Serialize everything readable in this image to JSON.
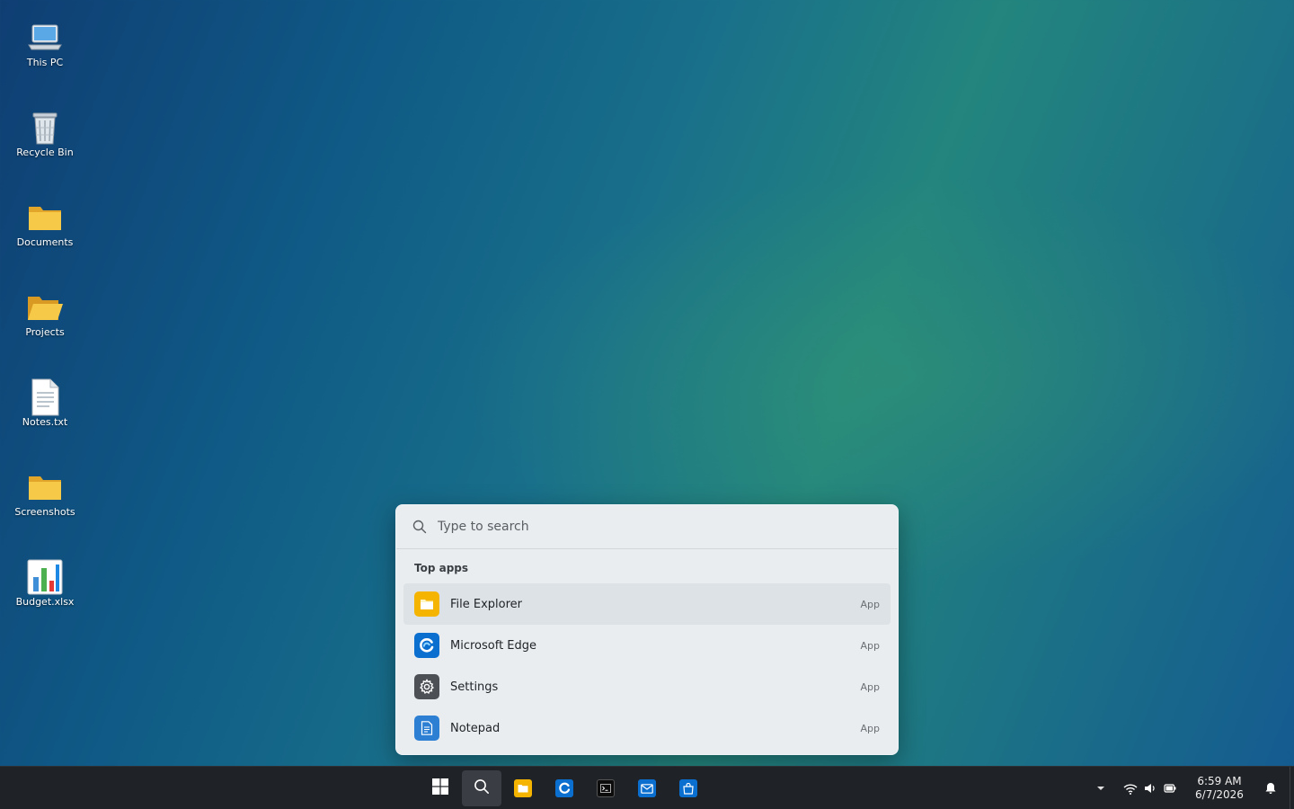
{
  "desktop": {
    "icons": [
      {
        "label": "This PC",
        "icon": "computer-icon"
      },
      {
        "label": "Recycle Bin",
        "icon": "recycle-bin-icon"
      },
      {
        "label": "Documents",
        "icon": "folder-icon"
      },
      {
        "label": "Projects",
        "icon": "open-folder-icon"
      },
      {
        "label": "Notes.txt",
        "icon": "text-file-icon"
      },
      {
        "label": "Screenshots",
        "icon": "folder-icon"
      },
      {
        "label": "Budget.xlsx",
        "icon": "spreadsheet-icon"
      }
    ]
  },
  "search": {
    "placeholder": "Type to search",
    "section_title": "Top apps",
    "results": [
      {
        "name": "File Explorer",
        "type": "App",
        "icon": "file-explorer-icon",
        "color": "#f4b400"
      },
      {
        "name": "Microsoft Edge",
        "type": "App",
        "icon": "edge-icon",
        "color": "#0b6fd0"
      },
      {
        "name": "Settings",
        "type": "App",
        "icon": "gear-icon",
        "color": "#4d5156"
      },
      {
        "name": "Notepad",
        "type": "App",
        "icon": "notepad-icon",
        "color": "#2d7fd4"
      }
    ]
  },
  "taskbar": {
    "pinned": [
      "start-icon",
      "search-icon",
      "file-explorer-icon",
      "edge-icon",
      "terminal-icon",
      "mail-icon",
      "store-icon"
    ],
    "tray": [
      "chevron-up-icon",
      "wifi-icon",
      "volume-icon",
      "battery-icon",
      "notification-bell-icon"
    ],
    "clock": {
      "time": "6:59 AM",
      "date": "6/7/2026"
    }
  },
  "colors": {
    "taskbar_bg": "#1f2226",
    "flyout_bg": "#e9edf0",
    "accent": "#0b6fd0"
  }
}
